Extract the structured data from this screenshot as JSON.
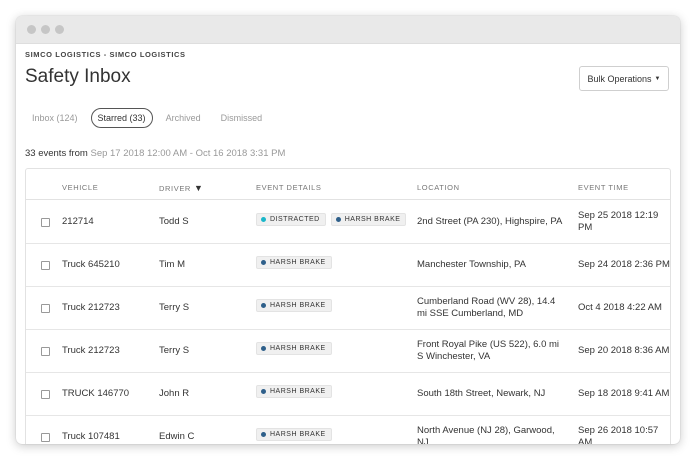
{
  "org_name": "SIMCO LOGISTICS - SIMCO LOGISTICS",
  "page_title": "Safety Inbox",
  "bulk_button": "Bulk Operations",
  "tabs": [
    {
      "label": "Inbox (124)",
      "active": false
    },
    {
      "label": "Starred (33)",
      "active": true
    },
    {
      "label": "Archived",
      "active": false
    },
    {
      "label": "Dismissed",
      "active": false
    }
  ],
  "summary": {
    "prefix": "33 events from",
    "range": "Sep 17 2018 12:00 AM - Oct 16 2018 3:31 PM"
  },
  "columns": {
    "vehicle": "VEHICLE",
    "driver": "DRIVER",
    "driver_sort": "▼",
    "event_details": "EVENT DETAILS",
    "location": "LOCATION",
    "event_time": "EVENT TIME"
  },
  "colors": {
    "distracted": "#1ab6c9",
    "harsh_brake": "#2e5f8a"
  },
  "rows": [
    {
      "vehicle": "212714",
      "driver": "Todd S",
      "events": [
        {
          "label": "DISTRACTED",
          "type": "distracted"
        },
        {
          "label": "HARSH BRAKE",
          "type": "harsh_brake"
        }
      ],
      "location": "2nd Street (PA 230), Highspire, PA",
      "time": "Sep 25 2018 12:19 PM"
    },
    {
      "vehicle": "Truck 645210",
      "driver": "Tim M",
      "events": [
        {
          "label": "HARSH BRAKE",
          "type": "harsh_brake"
        }
      ],
      "location": "Manchester Township, PA",
      "time": "Sep 24 2018 2:36 PM"
    },
    {
      "vehicle": "Truck 212723",
      "driver": "Terry S",
      "events": [
        {
          "label": "HARSH BRAKE",
          "type": "harsh_brake"
        }
      ],
      "location": "Cumberland Road (WV 28), 14.4 mi SSE Cumberland, MD",
      "time": "Oct 4 2018 4:22 AM"
    },
    {
      "vehicle": "Truck 212723",
      "driver": "Terry S",
      "events": [
        {
          "label": "HARSH BRAKE",
          "type": "harsh_brake"
        }
      ],
      "location": "Front Royal Pike (US 522), 6.0 mi S Winchester, VA",
      "time": "Sep 20 2018 8:36 AM"
    },
    {
      "vehicle": "TRUCK 146770",
      "driver": "John R",
      "events": [
        {
          "label": "HARSH BRAKE",
          "type": "harsh_brake"
        }
      ],
      "location": "South 18th Street, Newark, NJ",
      "time": "Sep 18 2018 9:41 AM"
    },
    {
      "vehicle": "Truck 107481",
      "driver": "Edwin C",
      "events": [
        {
          "label": "HARSH BRAKE",
          "type": "harsh_brake"
        }
      ],
      "location": "North Avenue (NJ 28), Garwood, NJ",
      "time": "Sep 26 2018 10:57 AM"
    }
  ]
}
